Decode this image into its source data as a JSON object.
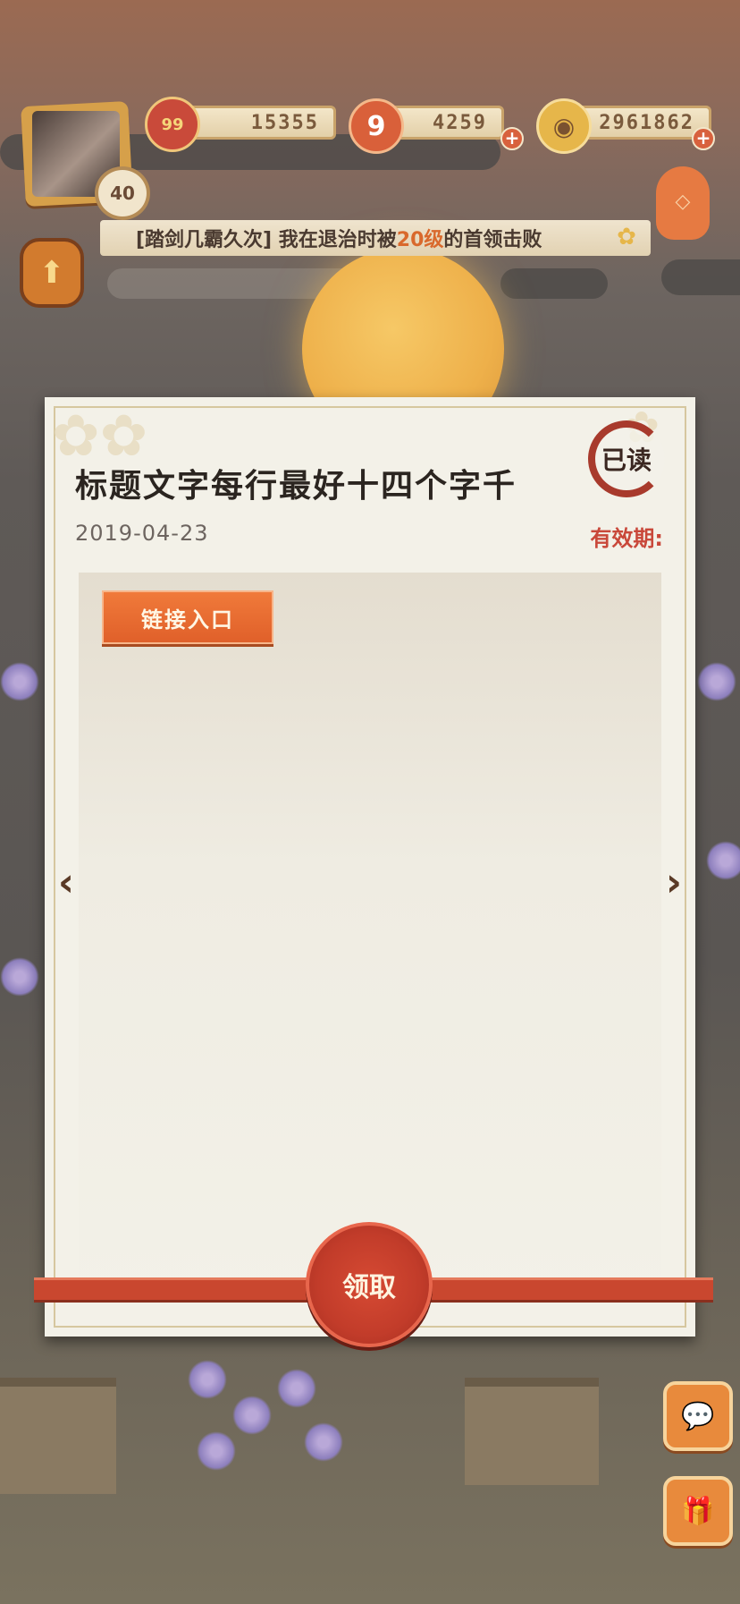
{
  "hud": {
    "level": "40",
    "resources": [
      {
        "name": "flower-points",
        "value": "15355",
        "icon_label": "99"
      },
      {
        "name": "nine-tokens",
        "value": "4259",
        "icon_label": "9"
      },
      {
        "name": "coins",
        "value": "2961862",
        "icon_label": "◉"
      }
    ]
  },
  "ticker": {
    "prefix": "[踏剑几霸久次] 我在退治时被",
    "highlight": "20级",
    "suffix": "的首领击败"
  },
  "mail": {
    "title": "标题文字每行最好十四个字千",
    "date": "2019-04-23",
    "validity_label": "有效期:",
    "read_stamp": "已读",
    "link_button": "链接入口",
    "claim_button": "领取"
  },
  "colors": {
    "accent": "#e0602a",
    "claim_red": "#c23c2a",
    "validity_red": "#c9483a",
    "card_bg": "#f3f1e8"
  }
}
